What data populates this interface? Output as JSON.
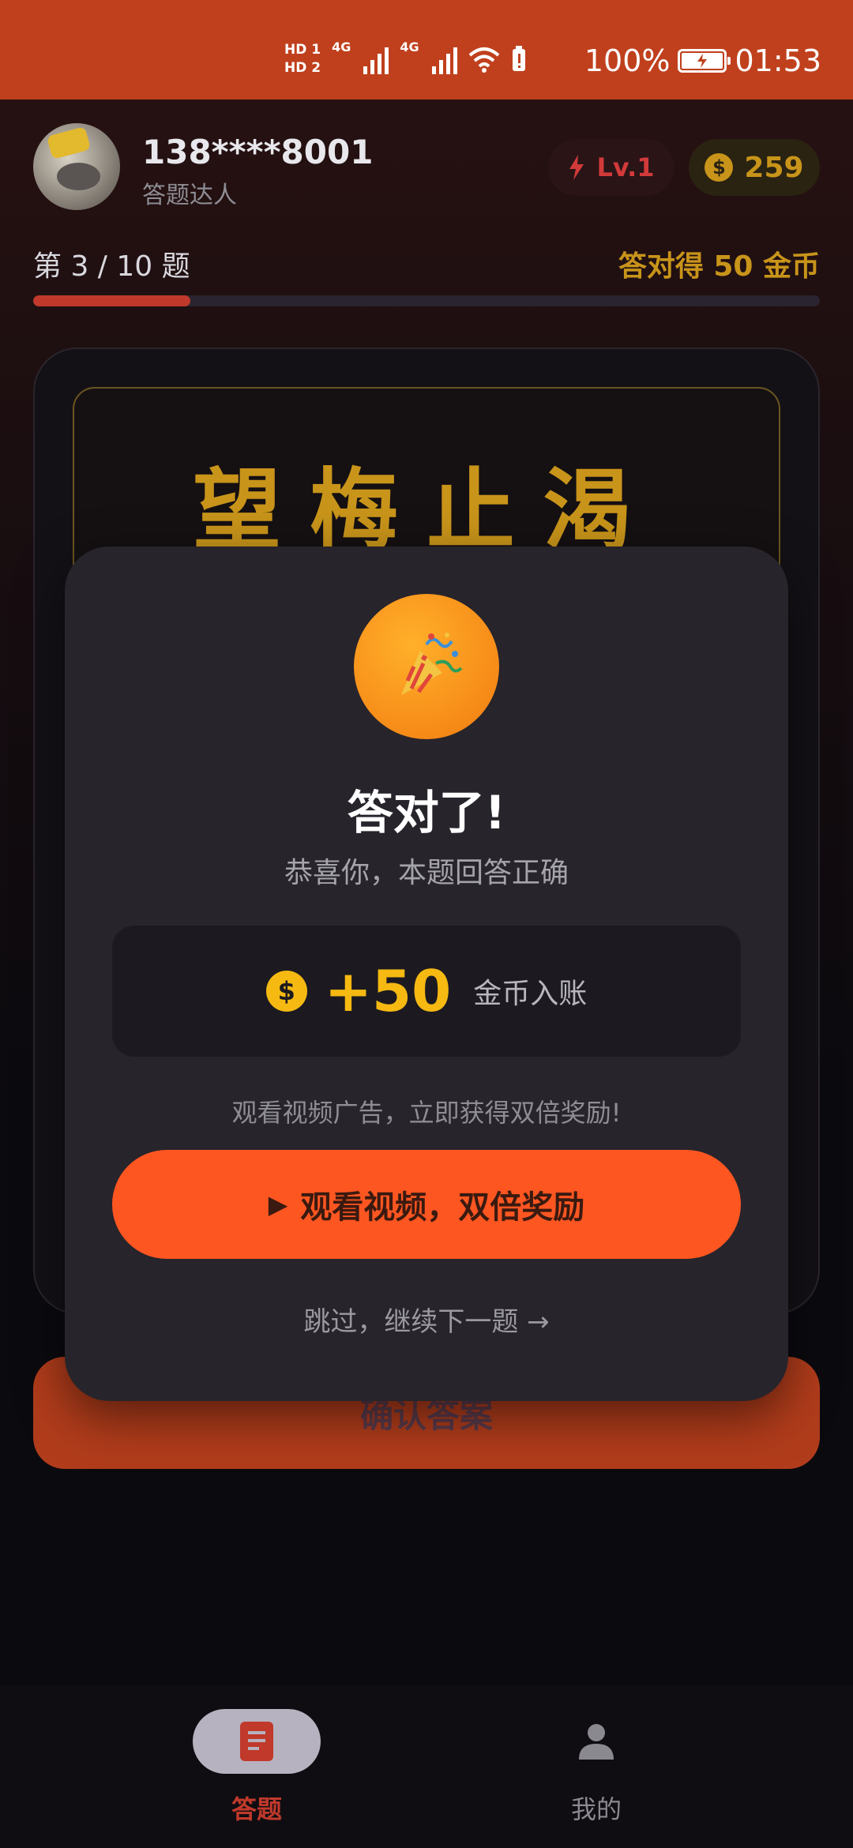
{
  "status_bar": {
    "sim1": "HD",
    "sim1_num": "1",
    "sim2": "HD",
    "sim2_num": "2",
    "net1": "4G",
    "net2": "4G",
    "battery_pct": "100%",
    "time": "01:53"
  },
  "user": {
    "phone": "138****8001",
    "title": "答题达人",
    "level": "Lv.1",
    "coins": "259"
  },
  "progress": {
    "label": "第 3 / 10 题",
    "reward": "答对得 50 金币",
    "fraction": 0.2
  },
  "question": {
    "idiom": "望梅止渴"
  },
  "confirm_label": "确认答案",
  "modal": {
    "title": "答对了!",
    "subtitle": "恭喜你，本题回答正确",
    "coin_symbol": "$",
    "amount": "+50",
    "amount_label": "金币入账",
    "hint": "观看视频广告，立即获得双倍奖励!",
    "watch_play": "▶",
    "watch_label": "观看视频，双倍奖励",
    "skip_label": "跳过，继续下一题 →"
  },
  "nav": {
    "items": [
      {
        "label": "答题",
        "icon": "document-icon",
        "active": true
      },
      {
        "label": "我的",
        "icon": "person-icon",
        "active": false
      }
    ]
  },
  "colors": {
    "status_bar": "#c0401d",
    "accent_gold": "#c8941a",
    "accent_red": "#c0392b",
    "watch_button": "#fe5621"
  }
}
